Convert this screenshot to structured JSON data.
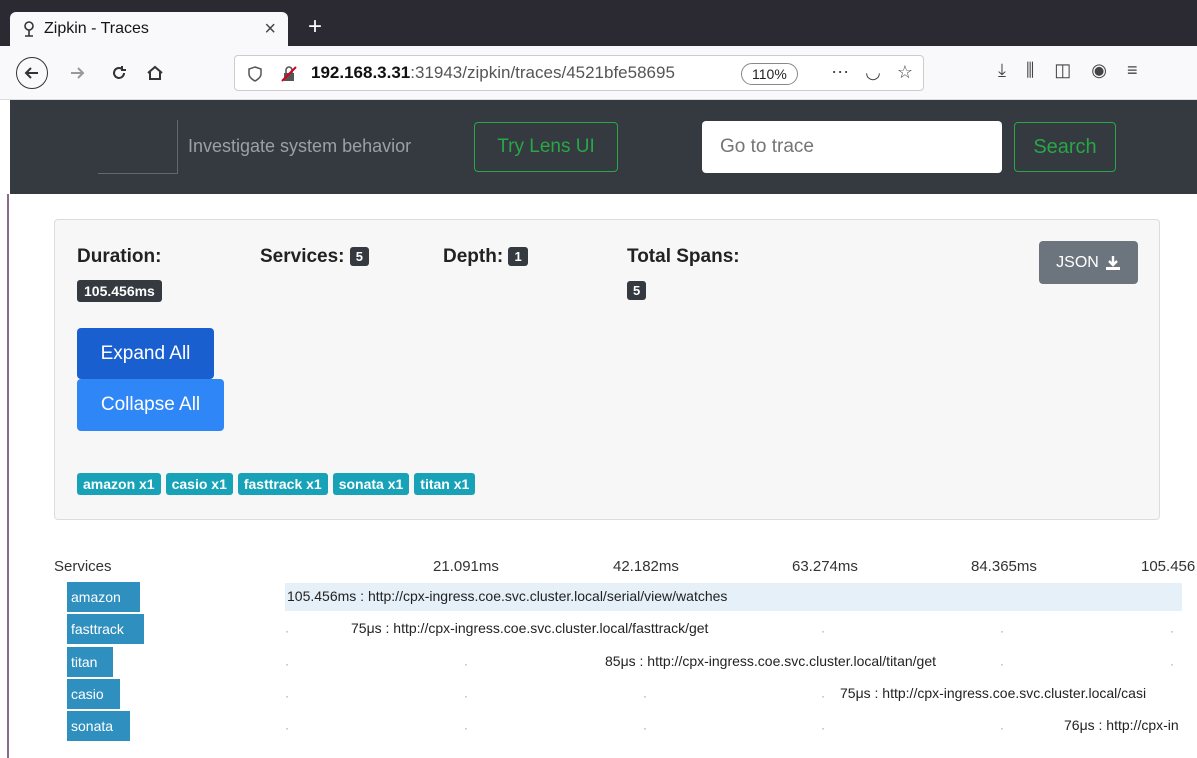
{
  "browser": {
    "tab_title": "Zipkin - Traces",
    "tab_close": "×",
    "new_tab": "+",
    "url_host": "192.168.3.31",
    "url_rest": ":31943/zipkin/traces/4521bfe58695",
    "zoom": "110%"
  },
  "header": {
    "tagline": "Investigate system behavior",
    "lens_button": "Try Lens UI",
    "trace_placeholder": "Go to trace",
    "search_button": "Search"
  },
  "summary": {
    "duration_label": "Duration:",
    "duration_value": "105.456ms",
    "services_label": "Services:",
    "services_value": "5",
    "depth_label": "Depth:",
    "depth_value": "1",
    "total_spans_label": "Total Spans:",
    "total_spans_value": "5",
    "json_button": "JSON",
    "expand_all": "Expand All",
    "collapse_all": "Collapse All",
    "service_tags": [
      "amazon x1",
      "casio x1",
      "fasttrack x1",
      "sonata x1",
      "titan x1"
    ]
  },
  "timeline": {
    "services_header": "Services",
    "ticks": [
      "21.091ms",
      "42.182ms",
      "63.274ms",
      "84.365ms",
      "105.456"
    ],
    "rows": [
      {
        "service": "amazon",
        "text": "105.456ms : http://cpx-ingress.coe.svc.cluster.local/serial/view/watches"
      },
      {
        "service": "fasttrack",
        "text": "75μs : http://cpx-ingress.coe.svc.cluster.local/fasttrack/get"
      },
      {
        "service": "titan",
        "text": "85μs : http://cpx-ingress.coe.svc.cluster.local/titan/get"
      },
      {
        "service": "casio",
        "text": "75μs : http://cpx-ingress.coe.svc.cluster.local/casi"
      },
      {
        "service": "sonata",
        "text": "76μs : http://cpx-in"
      }
    ]
  }
}
